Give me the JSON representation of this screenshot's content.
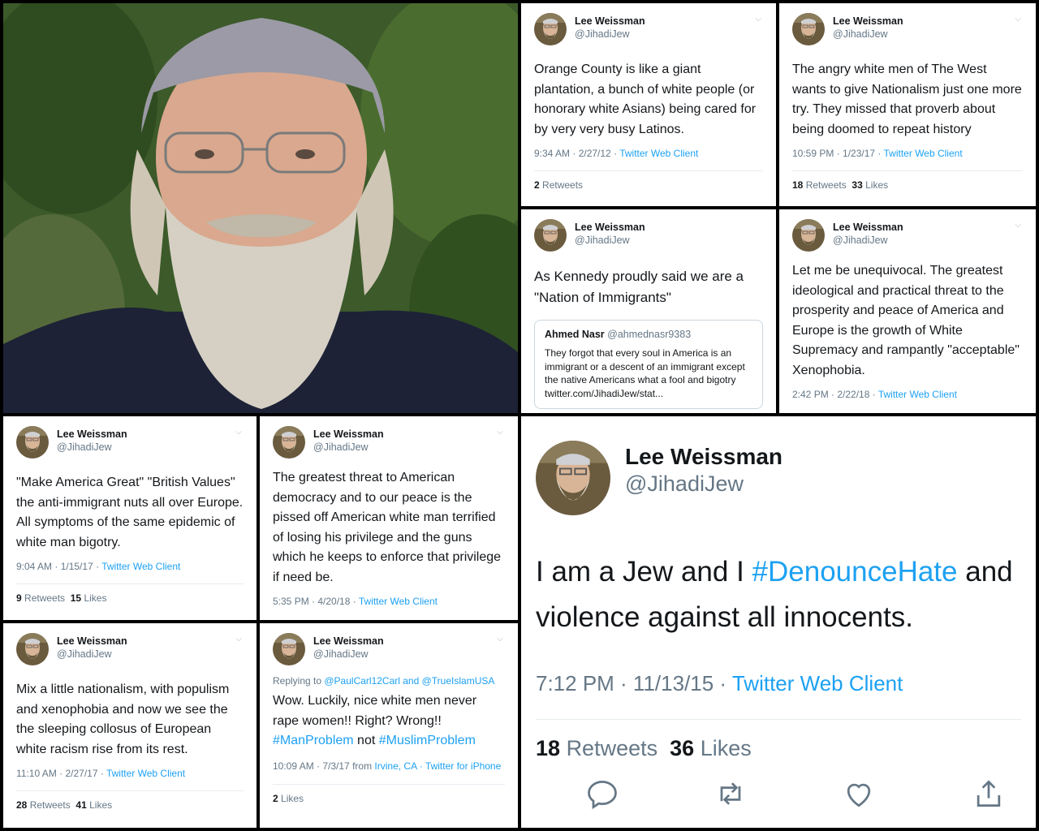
{
  "colors": {
    "link": "#1da1f2",
    "text": "#14171a",
    "muted": "#657786"
  },
  "tweets": {
    "t1": {
      "name": "Lee Weissman",
      "handle": "@JihadiJew",
      "text": "Orange County is like a giant plantation, a bunch of white people (or honorary white Asians) being cared for by very very busy Latinos.",
      "time": "9:34 AM · 2/27/12 · ",
      "client": "Twitter Web Client",
      "rt_count": "2",
      "rt_label": "Retweets"
    },
    "t2": {
      "name": "Lee Weissman",
      "handle": "@JihadiJew",
      "text": "The angry white men of The West wants to give Nationalism just one more try. They missed that proverb about being doomed to repeat history",
      "time": "10:59 PM · 1/23/17 · ",
      "client": "Twitter Web Client",
      "rt_count": "18",
      "rt_label": "Retweets",
      "like_count": "33",
      "like_label": "Likes"
    },
    "t3": {
      "name": "Lee Weissman",
      "handle": "@JihadiJew",
      "text": "As Kennedy proudly said we are a \"Nation of Immigrants\"",
      "quote_name": "Ahmed Nasr",
      "quote_handle": "@ahmednasr9383",
      "quote_text": "They forgot that every soul in America is an immigrant or a descent of an immigrant except the native Americans what a fool and bigotry twitter.com/JihadiJew/stat..."
    },
    "t4": {
      "name": "Lee Weissman",
      "handle": "@JihadiJew",
      "text": "Let me be unequivocal. The greatest ideological and practical threat to the prosperity and peace of America and Europe is the growth of White Supremacy and rampantly \"acceptable\" Xenophobia.",
      "time": "2:42 PM · 2/22/18 · ",
      "client": "Twitter Web Client"
    },
    "t5": {
      "name": "Lee Weissman",
      "handle": "@JihadiJew",
      "text": "\"Make America Great\"  \"British Values\" the anti-immigrant nuts all over Europe. All symptoms of the same epidemic of white man bigotry.",
      "time": "9:04 AM · 1/15/17 · ",
      "client": "Twitter Web Client",
      "rt_count": "9",
      "rt_label": "Retweets",
      "like_count": "15",
      "like_label": "Likes"
    },
    "t6": {
      "name": "Lee Weissman",
      "handle": "@JihadiJew",
      "text": "The greatest threat to American democracy and to our peace is the pissed off American white man terrified of losing his privilege and the guns which he keeps to enforce that privilege if need be.",
      "time": "5:35 PM · 4/20/18 · ",
      "client": "Twitter Web Client"
    },
    "t7": {
      "name": "Lee Weissman",
      "handle": "@JihadiJew",
      "text": "Mix a little nationalism, with populism and xenophobia and now we see the the sleeping collosus of European white racism rise from its rest.",
      "time": "11:10 AM · 2/27/17 · ",
      "client": "Twitter Web Client",
      "rt_count": "28",
      "rt_label": "Retweets",
      "like_count": "41",
      "like_label": "Likes"
    },
    "t8": {
      "name": "Lee Weissman",
      "handle": "@JihadiJew",
      "reply_prefix": "Replying to ",
      "reply_to": "@PaulCarl12Carl and @TrueIslamUSA",
      "text": "Wow.  Luckily, nice white men never rape women!!  Right? Wrong!!",
      "tag1": "#ManProblem",
      "tag_mid": " not ",
      "tag2": "#MuslimProblem",
      "time": "10:09 AM · 7/3/17 from ",
      "location": "Irvine, CA",
      "client": "· Twitter for iPhone",
      "like_count": "2",
      "like_label": "Likes"
    },
    "big": {
      "name": "Lee Weissman",
      "handle": "@JihadiJew",
      "text1": "I am a Jew and I ",
      "tag": "#DenounceHate",
      "text2": " and violence against all innocents.",
      "time": "7:12 PM · 11/13/15 · ",
      "client": "Twitter Web Client",
      "rt_count": "18",
      "rt_label": "Retweets",
      "like_count": "36",
      "like_label": "Likes",
      "icons": [
        "reply-icon",
        "retweet-icon",
        "like-icon",
        "share-icon"
      ]
    }
  }
}
